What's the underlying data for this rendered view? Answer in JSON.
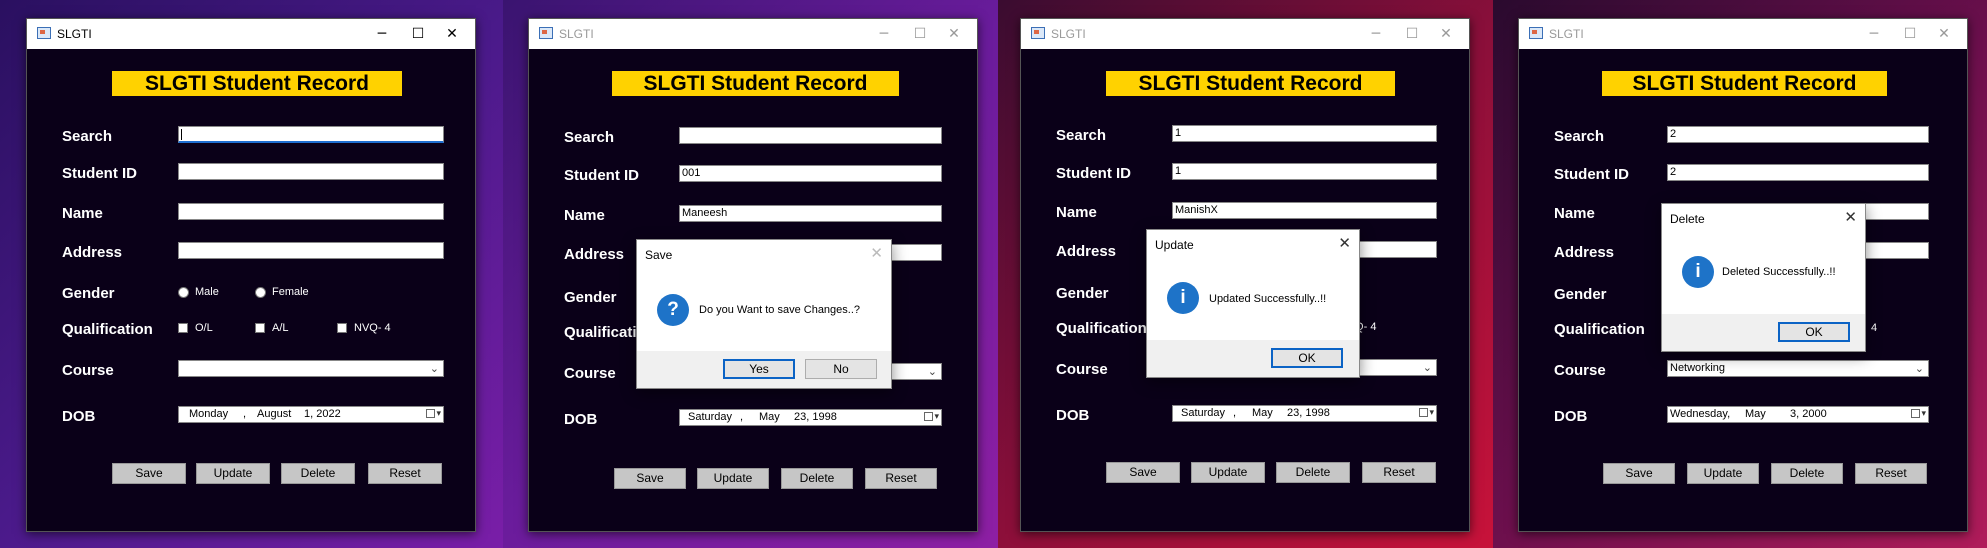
{
  "app_title": "SLGTI",
  "header_title": "SLGTI Student Record",
  "labels": {
    "search": "Search",
    "student_id": "Student ID",
    "name": "Name",
    "address": "Address",
    "gender": "Gender",
    "qualification": "Qualification",
    "course": "Course",
    "dob": "DOB"
  },
  "gender_options": [
    "Male",
    "Female"
  ],
  "qualification_options": [
    "O/L",
    "A/L",
    "NVQ- 4"
  ],
  "buttons": {
    "save": "Save",
    "update": "Update",
    "delete": "Delete",
    "reset": "Reset"
  },
  "title_controls": {
    "minimize": "─",
    "maximize": "☐",
    "close": "✕"
  },
  "colors": {
    "banner": "#ffd200",
    "window_bg": "#0a0018",
    "dialog_icon": "#1e73c8"
  },
  "windows": [
    {
      "state": "active",
      "search": "",
      "student_id": "",
      "name": "",
      "address": "",
      "course": "",
      "dob": {
        "day": "Monday",
        "sep": ",",
        "month": "August",
        "date": "1, 2022"
      }
    },
    {
      "state": "inactive",
      "search": "",
      "student_id": "001",
      "name": "Maneesh",
      "address": "",
      "course": "",
      "dob": {
        "day": "Saturday",
        "sep": ",",
        "month": "May",
        "date": "23, 1998"
      },
      "dialog": {
        "title": "Save",
        "icon": "question-icon",
        "icon_glyph": "?",
        "message": "Do you Want to save Changes..?",
        "buttons": [
          "Yes",
          "No"
        ]
      }
    },
    {
      "state": "inactive",
      "search": "1",
      "student_id": "1",
      "name": "ManishX",
      "address": "",
      "course": "",
      "nvq_partial": "/Q- 4",
      "dob": {
        "day": "Saturday",
        "sep": ",",
        "month": "May",
        "date": "23, 1998"
      },
      "dialog": {
        "title": "Update",
        "icon": "info-icon",
        "icon_glyph": "i",
        "message": "Updated Successfully..!!",
        "buttons": [
          "OK"
        ]
      }
    },
    {
      "state": "inactive",
      "search": "2",
      "student_id": "2",
      "name": "",
      "address": "",
      "course": "Networking",
      "nvq_partial": "4",
      "dob": {
        "day": "Wednesday,",
        "sep": "",
        "month": "May",
        "date": "3, 2000"
      },
      "dialog": {
        "title": "Delete",
        "icon": "info-icon",
        "icon_glyph": "i",
        "message": "Deleted Successfully..!!",
        "buttons": [
          "OK"
        ]
      }
    }
  ]
}
